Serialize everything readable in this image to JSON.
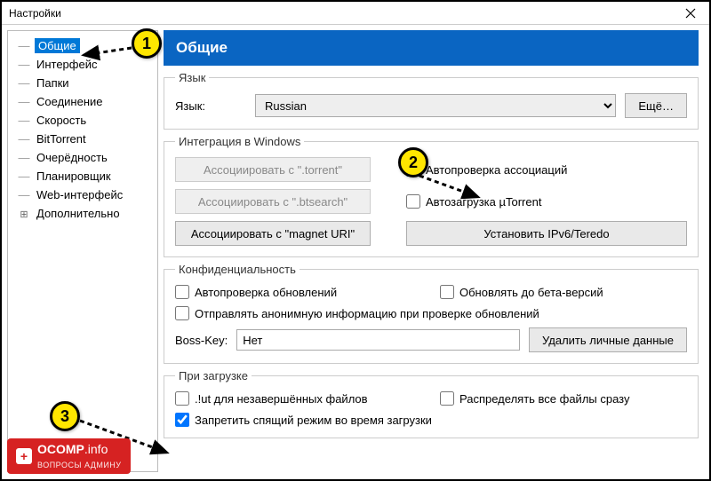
{
  "window": {
    "title": "Настройки"
  },
  "sidebar": {
    "items": [
      {
        "label": "Общие"
      },
      {
        "label": "Интерфейс"
      },
      {
        "label": "Папки"
      },
      {
        "label": "Соединение"
      },
      {
        "label": "Скорость"
      },
      {
        "label": "BitTorrent"
      },
      {
        "label": "Очерёдность"
      },
      {
        "label": "Планировщик"
      },
      {
        "label": "Web-интерфейс"
      },
      {
        "label": "Дополнительно"
      }
    ],
    "selected_index": 0
  },
  "main": {
    "heading": "Общие",
    "fieldsets": {
      "language": {
        "legend": "Язык",
        "label": "Язык:",
        "value": "Russian",
        "more_btn": "Ещё…"
      },
      "integration": {
        "legend": "Интеграция в Windows",
        "assoc_torrent_btn": "Ассоциировать с \".torrent\"",
        "assoc_btsearch_btn": "Ассоциировать с \".btsearch\"",
        "assoc_magnet_btn": "Ассоциировать с \"magnet URI\"",
        "check_assoc_chk": "Автопроверка ассоциаций",
        "check_assoc_val": true,
        "autoload_chk": "Автозагрузка µTorrent",
        "autoload_val": false,
        "ipv6_btn": "Установить IPv6/Teredo"
      },
      "privacy": {
        "legend": "Конфиденциальность",
        "check_updates_chk": "Автопроверка обновлений",
        "check_updates_val": false,
        "beta_chk": "Обновлять до бета-версий",
        "beta_val": false,
        "anon_chk": "Отправлять анонимную информацию при проверке обновлений",
        "anon_val": false,
        "bosskey_label": "Boss-Key:",
        "bosskey_value": "Нет",
        "delete_btn": "Удалить личные данные"
      },
      "download": {
        "legend": "При загрузке",
        "ut_chk": ".!ut для незавершённых файлов",
        "ut_val": false,
        "preallocate_chk": "Распределять все файлы сразу",
        "preallocate_val": false,
        "nosleep_chk": "Запретить спящий режим во время загрузки",
        "nosleep_val": true
      }
    }
  },
  "annotations": [
    "1",
    "2",
    "3"
  ],
  "watermark": {
    "brand": "OCOMP",
    "tld": ".info",
    "sub": "ВОПРОСЫ АДМИНУ"
  }
}
